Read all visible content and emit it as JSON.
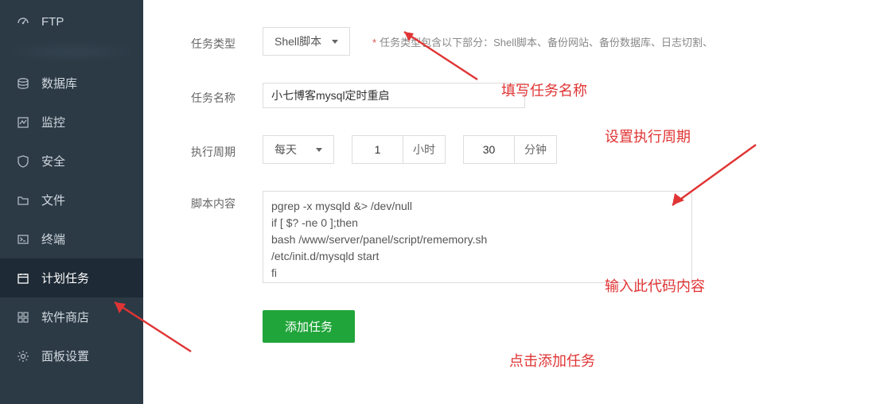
{
  "sidebar": {
    "items": [
      {
        "label": "FTP"
      },
      {
        "label": "数据库"
      },
      {
        "label": "监控"
      },
      {
        "label": "安全"
      },
      {
        "label": "文件"
      },
      {
        "label": "终端"
      },
      {
        "label": "计划任务"
      },
      {
        "label": "软件商店"
      },
      {
        "label": "面板设置"
      }
    ]
  },
  "form": {
    "task_type": {
      "label": "任务类型",
      "value": "Shell脚本",
      "hint_star": "*",
      "hint": "任务类型包含以下部分：Shell脚本、备份网站、备份数据库、日志切割、"
    },
    "task_name": {
      "label": "任务名称",
      "value": "小七博客mysql定时重启"
    },
    "period": {
      "label": "执行周期",
      "freq": "每天",
      "hour": "1",
      "hour_unit": "小时",
      "minute": "30",
      "minute_unit": "分钟"
    },
    "script": {
      "label": "脚本内容",
      "value": "pgrep -x mysqld &> /dev/null\nif [ $? -ne 0 ];then\nbash /www/server/panel/script/rememory.sh\n/etc/init.d/mysqld start\nfi"
    },
    "submit_label": "添加任务"
  },
  "annotations": {
    "name": "填写任务名称",
    "period": "设置执行周期",
    "code": "输入此代码内容",
    "submit": "点击添加任务"
  }
}
